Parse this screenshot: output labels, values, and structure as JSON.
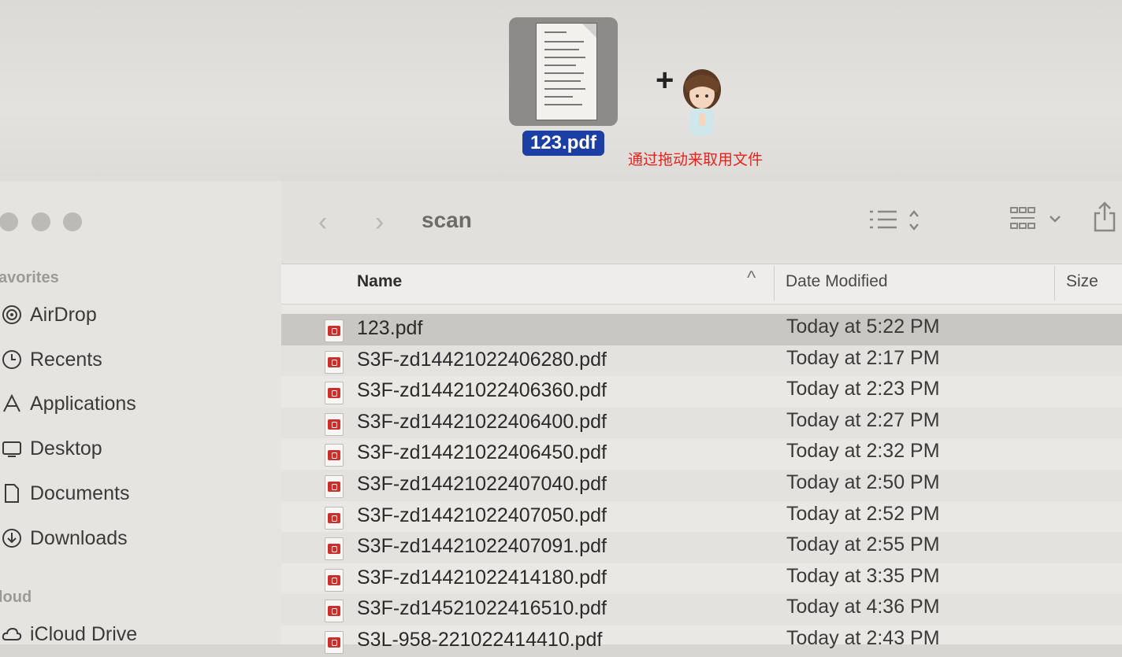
{
  "drag_preview": {
    "thumbnail_label": "123.pdf",
    "plus_symbol": "+",
    "hint_text": "通过拖动来取用文件",
    "hint_color": "#e8231e",
    "label_color": "#1c3fa3"
  },
  "window": {
    "title": "scan",
    "back_glyph": "‹",
    "forward_glyph": "›"
  },
  "sidebar": {
    "favorites_title": "avorites",
    "cloud_title": "loud",
    "favorites": [
      {
        "label": "AirDrop",
        "icon": "airdrop-icon"
      },
      {
        "label": "Recents",
        "icon": "clock-icon"
      },
      {
        "label": "Applications",
        "icon": "applications-icon"
      },
      {
        "label": "Desktop",
        "icon": "desktop-icon"
      },
      {
        "label": "Documents",
        "icon": "document-icon"
      },
      {
        "label": "Downloads",
        "icon": "download-icon"
      }
    ],
    "cloud": [
      {
        "label": "iCloud Drive",
        "icon": "cloud-icon"
      }
    ]
  },
  "columns": {
    "name": "Name",
    "date_modified": "Date Modified",
    "size": "Size",
    "sort_indicator": "^"
  },
  "files": [
    {
      "name": "123.pdf",
      "date": "Today at 5:22 PM",
      "selected": true
    },
    {
      "name": "S3F-zd14421022406280.pdf",
      "date": "Today at 2:17 PM"
    },
    {
      "name": "S3F-zd14421022406360.pdf",
      "date": "Today at 2:23 PM"
    },
    {
      "name": "S3F-zd14421022406400.pdf",
      "date": "Today at 2:27 PM"
    },
    {
      "name": "S3F-zd14421022406450.pdf",
      "date": "Today at 2:32 PM"
    },
    {
      "name": "S3F-zd14421022407040.pdf",
      "date": "Today at 2:50 PM"
    },
    {
      "name": "S3F-zd14421022407050.pdf",
      "date": "Today at 2:52 PM"
    },
    {
      "name": "S3F-zd14421022407091.pdf",
      "date": "Today at 2:55 PM"
    },
    {
      "name": "S3F-zd14421022414180.pdf",
      "date": "Today at 3:35 PM"
    },
    {
      "name": "S3F-zd14521022416510.pdf",
      "date": "Today at 4:36 PM"
    },
    {
      "name": "S3L-958-221022414410.pdf",
      "date": "Today at 2:43 PM"
    }
  ]
}
